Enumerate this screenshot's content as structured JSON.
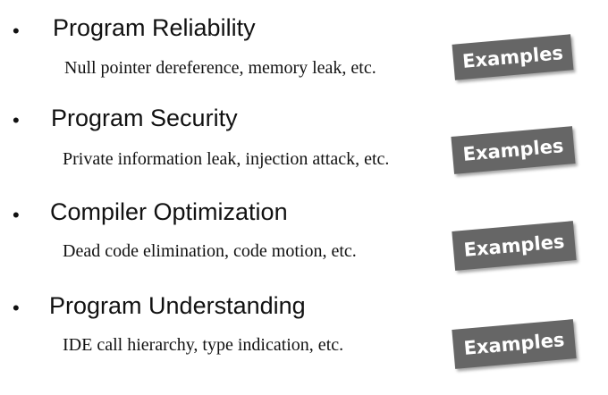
{
  "items": [
    {
      "title": "Program Reliability",
      "description": "Null pointer dereference, memory leak, etc.",
      "button_label": "Examples"
    },
    {
      "title": "Program Security",
      "description": "Private information leak, injection attack, etc.",
      "button_label": "Examples"
    },
    {
      "title": "Compiler Optimization",
      "description": "Dead code elimination, code motion, etc.",
      "button_label": "Examples"
    },
    {
      "title": "Program Understanding",
      "description": "IDE call hierarchy, type indication, etc.",
      "button_label": "Examples"
    }
  ],
  "bullet_glyph": "•",
  "colors": {
    "text": "#111111",
    "button_bg": "#666666",
    "button_text": "#ffffff",
    "page_bg": "#ffffff"
  }
}
